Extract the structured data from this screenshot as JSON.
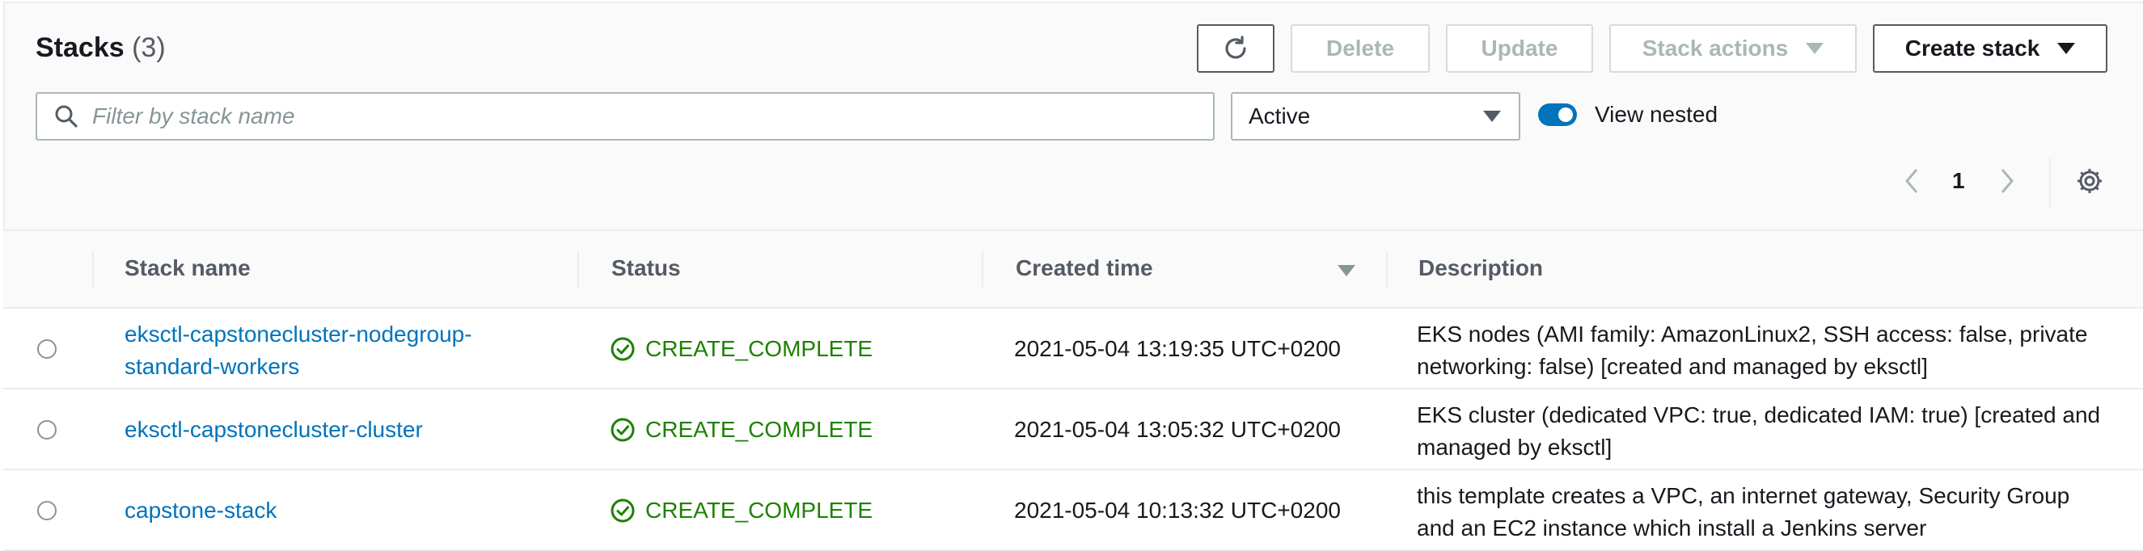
{
  "header": {
    "title": "Stacks",
    "count": "(3)"
  },
  "toolbar": {
    "delete_label": "Delete",
    "update_label": "Update",
    "stack_actions_label": "Stack actions",
    "create_stack_label": "Create stack"
  },
  "filter": {
    "search_placeholder": "Filter by stack name",
    "status_selected": "Active",
    "view_nested_label": "View nested",
    "view_nested_on": true
  },
  "pagination": {
    "current_page": "1"
  },
  "table": {
    "columns": [
      "Stack name",
      "Status",
      "Created time",
      "Description"
    ],
    "rows": [
      {
        "name_line1": "eksctl-capstonecluster-nodegroup-",
        "name_line2": "standard-workers",
        "status": "CREATE_COMPLETE",
        "created": "2021-05-04 13:19:35 UTC+0200",
        "desc_line1": "EKS nodes (AMI family: AmazonLinux2, SSH access: false, private",
        "desc_line2": "networking: false) [created and managed by eksctl]"
      },
      {
        "name_line1": "eksctl-capstonecluster-cluster",
        "status": "CREATE_COMPLETE",
        "created": "2021-05-04 13:05:32 UTC+0200",
        "desc_line1": "EKS cluster (dedicated VPC: true, dedicated IAM: true) [created and",
        "desc_line2": "managed by eksctl]"
      },
      {
        "name_line1": "capstone-stack",
        "status": "CREATE_COMPLETE",
        "created": "2021-05-04 10:13:32 UTC+0200",
        "desc_line1": "this template creates a VPC, an internet gateway, Security Group",
        "desc_line2": "and an EC2 instance which install a Jenkins server"
      }
    ]
  },
  "colors": {
    "link": "#0073bb",
    "success": "#1d8102",
    "toggle": "#0073bb"
  }
}
